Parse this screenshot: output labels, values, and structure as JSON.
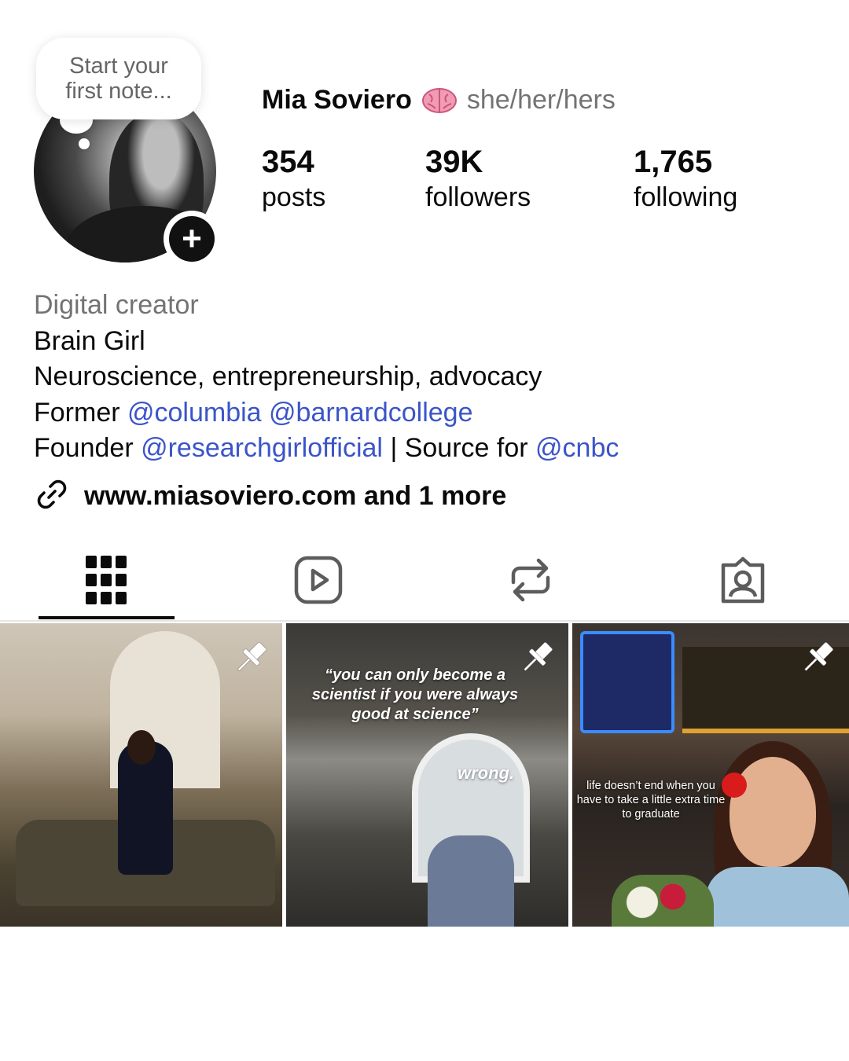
{
  "note": {
    "text": "Start your first note..."
  },
  "profile": {
    "name": "Mia Soviero",
    "name_emoji": "brain-icon",
    "pronouns": "she/her/hers",
    "add_story_label": "+"
  },
  "stats": [
    {
      "value": "354",
      "label": "posts"
    },
    {
      "value": "39K",
      "label": "followers"
    },
    {
      "value": "1,765",
      "label": "following"
    }
  ],
  "bio": {
    "category": "Digital creator",
    "line1": "Brain Girl",
    "line2": "Neuroscience, entrepreneurship, advocacy",
    "line3_prefix": "Former ",
    "line3_mention1": "@columbia",
    "line3_mention2": "@barnardcollege",
    "line4_prefix": "Founder ",
    "line4_mention1": "@researchgirlofficial",
    "line4_middle": " | Source for ",
    "line4_mention2": "@cnbc"
  },
  "link": {
    "text": "www.miasoviero.com and 1 more",
    "icon": "link-icon"
  },
  "tabs": [
    {
      "name": "grid",
      "icon": "grid-icon",
      "active": true
    },
    {
      "name": "reels",
      "icon": "reels-icon",
      "active": false
    },
    {
      "name": "reposts",
      "icon": "repost-icon",
      "active": false
    },
    {
      "name": "tagged",
      "icon": "tagged-icon",
      "active": false
    }
  ],
  "posts": [
    {
      "pinned": true,
      "overlay_text": ""
    },
    {
      "pinned": true,
      "overlay_quote": "“you can only become a scientist if you were always good at science”",
      "overlay_answer": "wrong."
    },
    {
      "pinned": true,
      "overlay_text": "life doesn’t end when you have to take a little extra time to graduate"
    }
  ],
  "colors": {
    "mention": "#3b55c8",
    "secondary_text": "#737373",
    "primary_text": "#0a0a0a"
  }
}
